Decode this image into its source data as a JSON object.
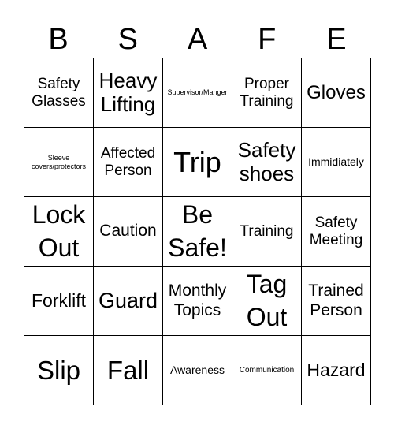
{
  "header": [
    "B",
    "S",
    "A",
    "F",
    "E"
  ],
  "cells": [
    [
      "Safety Glasses",
      "Heavy Lifting",
      "Supervisor/Manger",
      "Proper Training",
      "Gloves"
    ],
    [
      "Sleeve covers/protectors",
      "Affected Person",
      "Trip",
      "Safety shoes",
      "Immidiately"
    ],
    [
      "Lock Out",
      "Caution",
      "Be Safe!",
      "Training",
      "Safety Meeting"
    ],
    [
      "Forklift",
      "Guard",
      "Monthly Topics",
      "Tag Out",
      "Trained Person"
    ],
    [
      "Slip",
      "Fall",
      "Awareness",
      "Communication",
      "Hazard"
    ]
  ]
}
